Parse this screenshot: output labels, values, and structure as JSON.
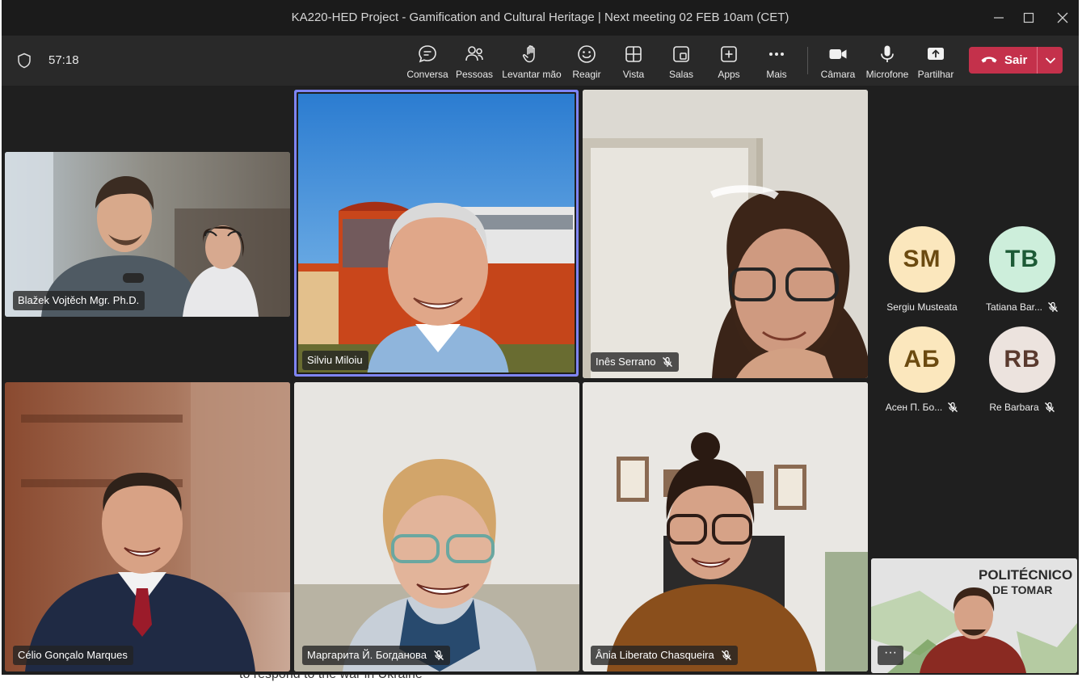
{
  "window": {
    "title": "KA220-HED Project - Gamification and Cultural Heritage | Next meeting 02 FEB 10am (CET)"
  },
  "toolbar": {
    "timer": "57:18",
    "buttons": {
      "chat": "Conversa",
      "people": "Pessoas",
      "raise": "Levantar mão",
      "react": "Reagir",
      "view": "Vista",
      "rooms": "Salas",
      "apps": "Apps",
      "more": "Mais",
      "camera": "Câmara",
      "mic": "Microfone",
      "share": "Partilhar"
    },
    "leave_label": "Sair"
  },
  "participants": {
    "blazek": "Blažek Vojtěch Mgr. Ph.D.",
    "silviu": "Silviu Miloiu",
    "ines": "Inês Serrano",
    "celio": "Célio Gonçalo Marques",
    "margarita": "Маргарита Й. Богданова",
    "ania": "Ânia Liberato Chasqueira"
  },
  "avatars": [
    {
      "initials": "SM",
      "name": "Sergiu Musteata",
      "muted": false,
      "bg": "#fbe7bd",
      "fg": "#6b4a10"
    },
    {
      "initials": "TB",
      "name": "Tatiana Bar...",
      "muted": true,
      "bg": "#cdeedb",
      "fg": "#1d5a36"
    },
    {
      "initials": "АБ",
      "name": "Асен П. Бо...",
      "muted": true,
      "bg": "#fbe7bd",
      "fg": "#6b4a10"
    },
    {
      "initials": "RB",
      "name": "Re Barbara",
      "muted": true,
      "bg": "#ece3de",
      "fg": "#5a3a2e"
    }
  ],
  "self_view": {
    "more_label": "···",
    "banner_line1": "POLITÉCNICO",
    "banner_line2": "DE TOMAR"
  },
  "background_text": "to respond to the war in Ukraine"
}
